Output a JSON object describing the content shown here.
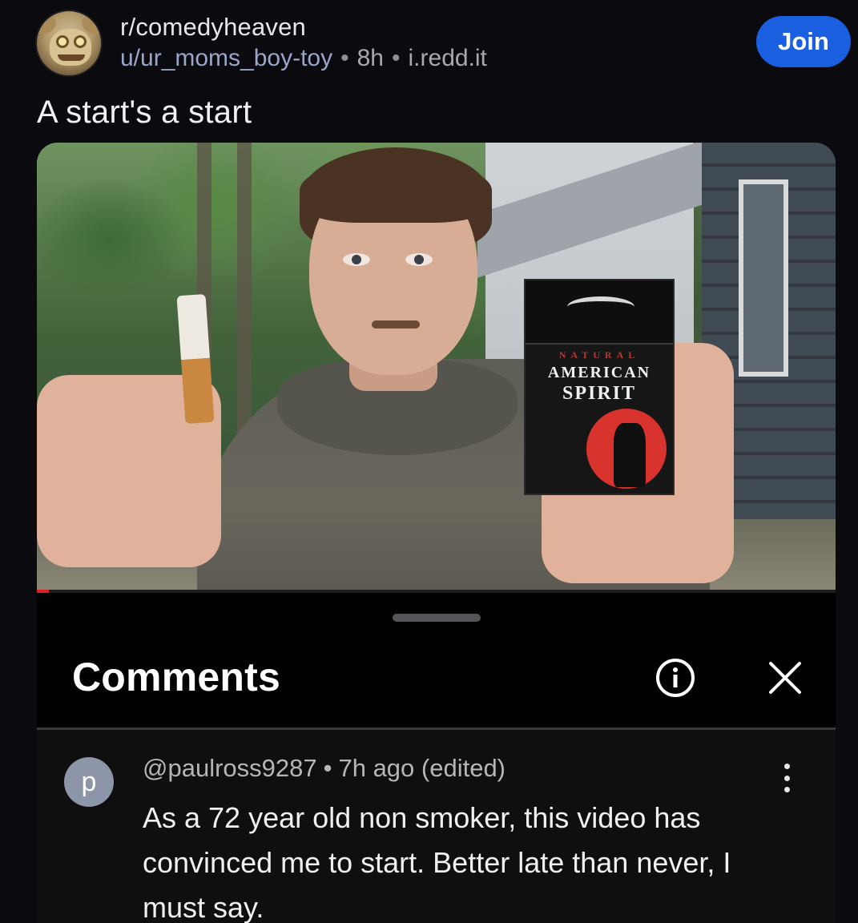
{
  "post": {
    "subreddit": "r/comedyheaven",
    "author": "u/ur_moms_boy-toy",
    "age": "8h",
    "domain": "i.redd.it",
    "separator": "•",
    "join_label": "Join",
    "title": "A start's a start",
    "subreddit_avatar_icon": "subreddit-avatar-icon"
  },
  "embedded_screenshot": {
    "brand_line_1": "NATURAL",
    "brand_line_2": "AMERICAN",
    "brand_line_3": "SPIRIT",
    "video_progress_fraction": 0.015,
    "comments_panel": {
      "title": "Comments",
      "info_icon": "info-icon",
      "close_icon": "close-icon"
    },
    "comment": {
      "avatar_letter": "p",
      "handle": "@paulross9287",
      "separator": "•",
      "timestamp": "7h ago (edited)",
      "menu_icon": "more-vertical-icon",
      "text": "As a 72 year old non smoker,  this video has convinced me to start. Better late than never, I must say."
    }
  },
  "colors": {
    "background": "#0b0b0f",
    "join_button": "#1a5fe0",
    "progress_played": "#e01e1e",
    "comment_avatar": "#8c96a8"
  }
}
